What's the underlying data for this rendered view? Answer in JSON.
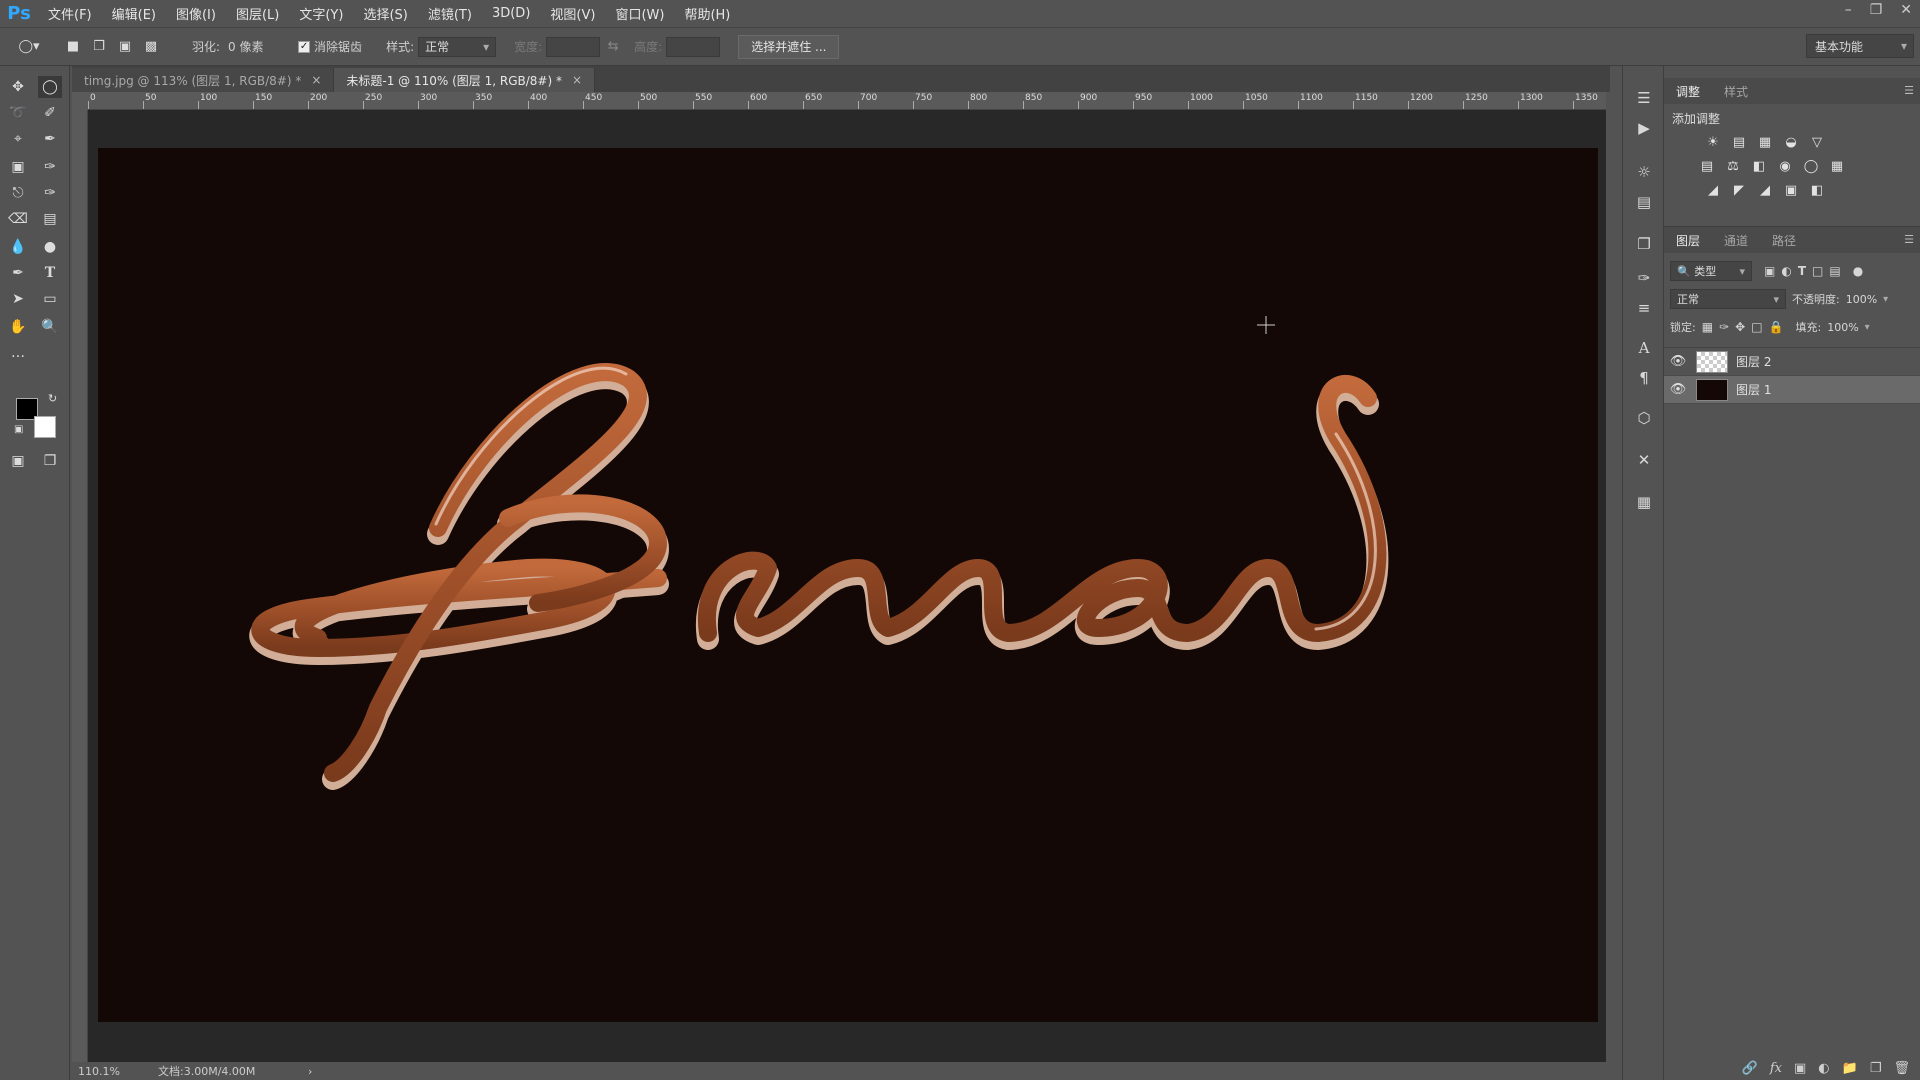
{
  "app": {
    "logo": "Ps"
  },
  "menu": [
    "文件(F)",
    "编辑(E)",
    "图像(I)",
    "图层(L)",
    "文字(Y)",
    "选择(S)",
    "滤镜(T)",
    "3D(D)",
    "视图(V)",
    "窗口(W)",
    "帮助(H)"
  ],
  "options": {
    "feather_label": "羽化:",
    "feather_value": "0 像素",
    "antialias_label": "消除锯齿",
    "style_label": "样式:",
    "style_value": "正常",
    "width_label": "宽度:",
    "height_label": "高度:",
    "select_mask_button": "选择并遮住 ...",
    "workspace": "基本功能"
  },
  "tabs": [
    {
      "label": "timg.jpg @ 113% (图层 1, RGB/8#) *",
      "close": "×",
      "active": false
    },
    {
      "label": "未标题-1 @ 110% (图层 1, RGB/8#) *",
      "close": "×",
      "active": true
    }
  ],
  "ruler_ticks": [
    "0",
    "50",
    "100",
    "150",
    "200",
    "250",
    "300",
    "350",
    "400",
    "450",
    "500",
    "550",
    "600",
    "650",
    "700",
    "750",
    "800",
    "850",
    "900",
    "950",
    "1000",
    "1050",
    "1100",
    "1150",
    "1200",
    "1250",
    "1300",
    "1350"
  ],
  "canvas": {
    "background": "#130805",
    "text_color": "#a0512a"
  },
  "status": {
    "zoom": "110.1%",
    "doc": "文档:3.00M/4.00M",
    "arrow": "›"
  },
  "adjustments_panel": {
    "tabs": [
      "调整",
      "样式"
    ],
    "title": "添加调整"
  },
  "layers_panel": {
    "tabs": [
      "图层",
      "通道",
      "路径"
    ],
    "filter_kind": "类型",
    "blend_mode": "正常",
    "opacity_label": "不透明度:",
    "opacity_value": "100%",
    "lock_label": "锁定:",
    "fill_label": "填充:",
    "fill_value": "100%",
    "layers": [
      {
        "name": "图层 2",
        "thumb": "transparent",
        "selected": false
      },
      {
        "name": "图层 1",
        "thumb": "dark",
        "selected": true
      }
    ]
  }
}
